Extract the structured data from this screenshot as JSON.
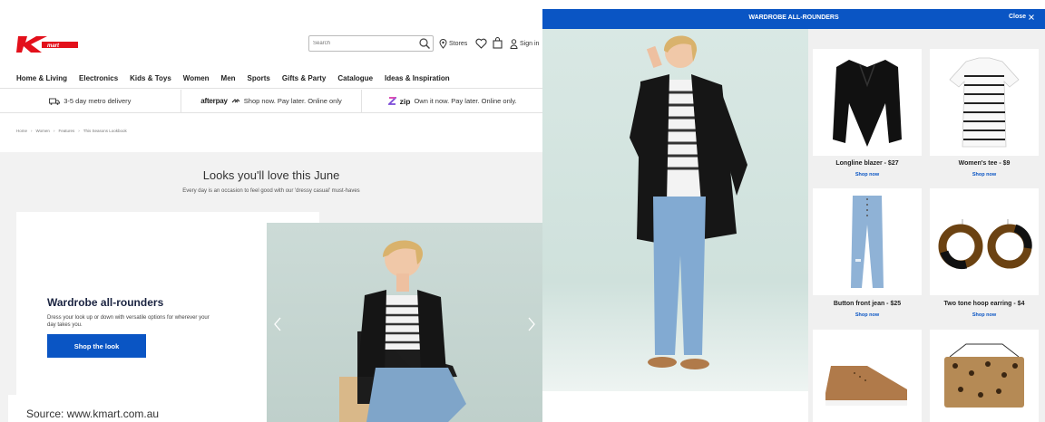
{
  "header": {
    "search_placeholder": "Search",
    "stores_label": "Stores",
    "signin_label": "Sign in"
  },
  "nav": {
    "items": [
      "Home & Living",
      "Electronics",
      "Kids & Toys",
      "Women",
      "Men",
      "Sports",
      "Gifts & Party",
      "Catalogue",
      "Ideas & Inspiration"
    ]
  },
  "promo": {
    "delivery": "3-5 day metro delivery",
    "afterpay_brand": "afterpay",
    "afterpay_text": "Shop now. Pay later. Online only",
    "zip_brand": "zip",
    "zip_text": "Own it now. Pay later. Online only."
  },
  "breadcrumb": [
    "Home",
    "Women",
    "Features",
    "This Seasons Lookbook"
  ],
  "hero": {
    "title": "Looks you'll love this June",
    "subtitle": "Every day is an occasion to feel good with our 'dressy casual' must-haves"
  },
  "card": {
    "title": "Wardrobe all-rounders",
    "text": "Dress your look up or down with versatile options for wherever your day takes you.",
    "button": "Shop the look"
  },
  "source": "Source: www.kmart.com.au",
  "modal": {
    "title": "WARDROBE ALL-ROUNDERS",
    "close_label": "Close",
    "products": [
      {
        "name": "Longline blazer - $27",
        "link": "Shop now"
      },
      {
        "name": "Women's tee - $9",
        "link": "Shop now"
      },
      {
        "name": "Button front jean - $25",
        "link": "Shop now"
      },
      {
        "name": "Two tone hoop earring - $4",
        "link": "Shop now"
      },
      {
        "name": "",
        "link": ""
      },
      {
        "name": "",
        "link": ""
      }
    ]
  },
  "colors": {
    "brand_red": "#e3101b",
    "accent_blue": "#0a55c4"
  }
}
